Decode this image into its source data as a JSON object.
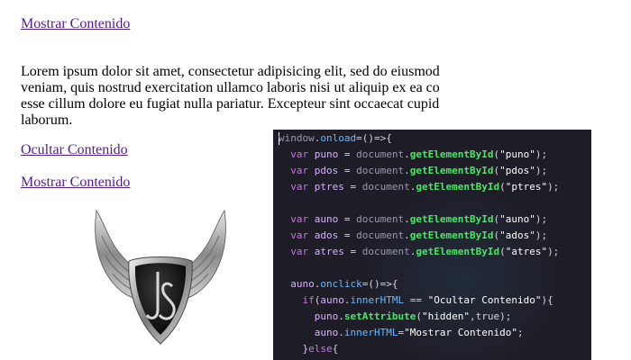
{
  "links": {
    "show_top": "Mostrar Contenido",
    "hide": "Ocultar Contenido",
    "show_bottom": "Mostrar Contenido"
  },
  "paragraph": [
    "Lorem ipsum dolor sit amet, consectetur adipisicing elit, sed do eiusmod",
    "veniam, quis nostrud exercitation ullamco laboris nisi ut aliquip ex ea co",
    "esse cillum dolore eu fugiat nulla pariatur. Excepteur sint occaecat cupid",
    "laborum."
  ],
  "logo": {
    "icon": "winged-shield-js-logo",
    "letters": "JS"
  },
  "code": {
    "lines": [
      "window.onload=()=>{",
      "  var puno = document.getElementById(\"puno\");",
      "  var pdos = document.getElementById(\"pdos\");",
      "  var ptres = document.getElementById(\"ptres\");",
      "",
      "  var auno = document.getElementById(\"auno\");",
      "  var ados = document.getElementById(\"ados\");",
      "  var atres = document.getElementById(\"atres\");",
      "",
      "  auno.onclick=()=>{",
      "    if(auno.innerHTML == \"Ocultar Contenido\"){",
      "      puno.setAttribute(\"hidden\",true);",
      "      auno.innerHTML=\"Mostrar Contenido\";",
      "    }else{"
    ]
  }
}
